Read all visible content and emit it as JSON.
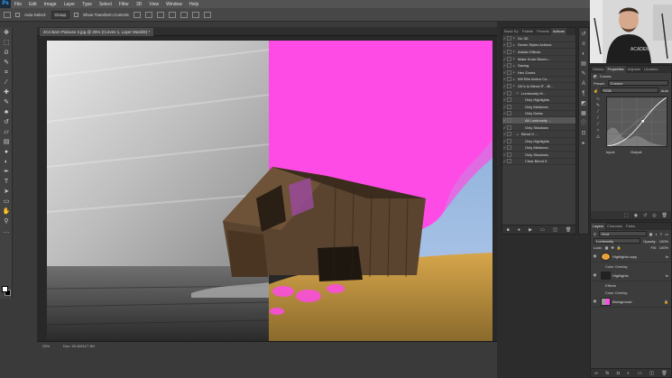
{
  "app": {
    "logo": "Ps"
  },
  "menu": [
    "File",
    "Edit",
    "Image",
    "Layer",
    "Type",
    "Select",
    "Filter",
    "3D",
    "View",
    "Window",
    "Help"
  ],
  "options_bar": {
    "auto_select_label": "Auto-Select:",
    "auto_select_value": "Group",
    "transform_label": "Show Transform Controls"
  },
  "document": {
    "tab_title": "4Cs Barn Palouse 2.jpg @ 25% (Curves 1, Layer Mask/8) *",
    "zoom": "25%",
    "doc_size": "Doc: 50.4M/117.3M"
  },
  "actions_panel": {
    "tabs": [
      "Basic Ep",
      "Palette",
      "Presets",
      "Actions"
    ],
    "active_tab": "Actions",
    "rows": [
      {
        "label": "Go 3D",
        "indent": 0,
        "checked": true,
        "selected": false
      },
      {
        "label": "Seven Styles Actions",
        "indent": 0,
        "checked": true,
        "selected": false
      },
      {
        "label": "Artistic Effects",
        "indent": 0,
        "checked": true,
        "selected": false
      },
      {
        "label": "Make Kudo Bloom...",
        "indent": 0,
        "checked": true,
        "selected": false
      },
      {
        "label": "Saving",
        "indent": 0,
        "checked": true,
        "selected": false
      },
      {
        "label": "Hex Zones",
        "indent": 0,
        "checked": true,
        "selected": false
      },
      {
        "label": "Wil Ellis Action Co...",
        "indent": 0,
        "checked": true,
        "selected": false
      },
      {
        "label": "GK's to Blend IF - Bl...",
        "indent": 0,
        "checked": true,
        "selected": false
      },
      {
        "label": "Luminosity M...",
        "indent": 1,
        "checked": true,
        "selected": false
      },
      {
        "label": "Only Highlights",
        "indent": 2,
        "checked": true,
        "selected": false
      },
      {
        "label": "Only Midtones",
        "indent": 2,
        "checked": true,
        "selected": false
      },
      {
        "label": "Only Darks",
        "indent": 2,
        "checked": true,
        "selected": false
      },
      {
        "label": "All Luminosity ...",
        "indent": 2,
        "checked": true,
        "selected": true
      },
      {
        "label": "Only Shadows",
        "indent": 2,
        "checked": true,
        "selected": false
      },
      {
        "label": "Blend If ...",
        "indent": 1,
        "checked": true,
        "selected": false
      },
      {
        "label": "Only Highlights",
        "indent": 2,
        "checked": true,
        "selected": false
      },
      {
        "label": "Only Midtones",
        "indent": 2,
        "checked": true,
        "selected": false
      },
      {
        "label": "Only Shadows",
        "indent": 2,
        "checked": true,
        "selected": false
      },
      {
        "label": "Clear Blend If",
        "indent": 2,
        "checked": true,
        "selected": false
      }
    ],
    "footer_icons": [
      "stop-icon",
      "record-icon",
      "play-icon",
      "folder-icon",
      "new-icon",
      "delete-icon"
    ]
  },
  "properties_panel": {
    "tabs": [
      "History",
      "Properties",
      "Adjustm",
      "Libraries"
    ],
    "active_tab": "Properties",
    "title": "Curves",
    "preset_label": "Preset:",
    "preset_value": "Custom",
    "channel_value": "RGB",
    "auto_label": "Auto",
    "input_label": "Input:",
    "output_label": "Output:"
  },
  "layers_panel": {
    "tabs": [
      "Layers",
      "Channels",
      "Paths"
    ],
    "active_tab": "Layers",
    "kind_label": "Kind",
    "blend_mode": "Luminosity",
    "opacity_label": "Opacity:",
    "opacity": "100%",
    "lock_label": "Lock:",
    "fill_label": "Fill:",
    "fill": "100%",
    "layers": [
      {
        "name": "Highlights copy",
        "sub": [
          "Color Overlay"
        ]
      },
      {
        "name": "Highlights",
        "sub": [
          "Effects",
          "Color Overlay"
        ]
      },
      {
        "name": "Background",
        "sub": []
      }
    ]
  },
  "colors": {
    "magenta": "#ff4be6",
    "selection_orange": "#e8a23a",
    "highlight_row": "#575757"
  }
}
